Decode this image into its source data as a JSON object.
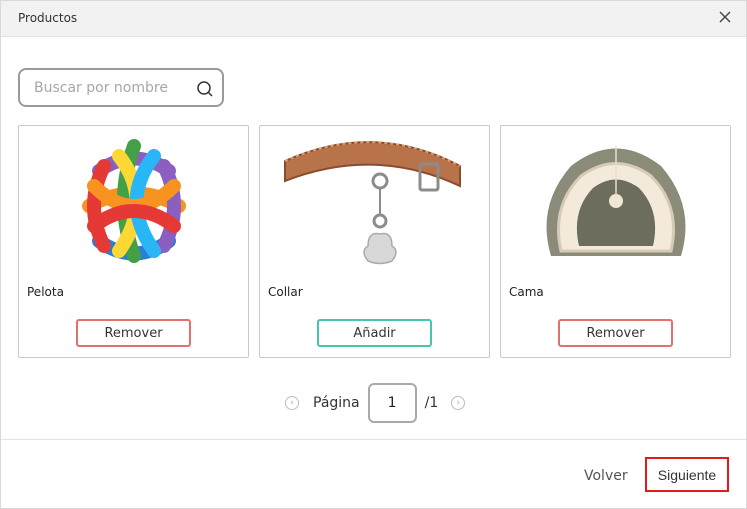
{
  "dialog": {
    "title": "Productos"
  },
  "search": {
    "placeholder": "Buscar por nombre",
    "value": ""
  },
  "products": [
    {
      "name": "Pelota",
      "action": "Remover",
      "action_type": "remove",
      "image": "colorful-ball"
    },
    {
      "name": "Collar",
      "action": "Añadir",
      "action_type": "add",
      "image": "leather-collar"
    },
    {
      "name": "Cama",
      "action": "Remover",
      "action_type": "remove",
      "image": "pet-bed"
    }
  ],
  "pagination": {
    "label": "Página",
    "current": "1",
    "total": "/1"
  },
  "footer": {
    "back_label": "Volver",
    "next_label": "Siguiente"
  },
  "colors": {
    "remove_border": "#e0716e",
    "add_border": "#46c6ad",
    "highlight": "#e01b1b"
  }
}
